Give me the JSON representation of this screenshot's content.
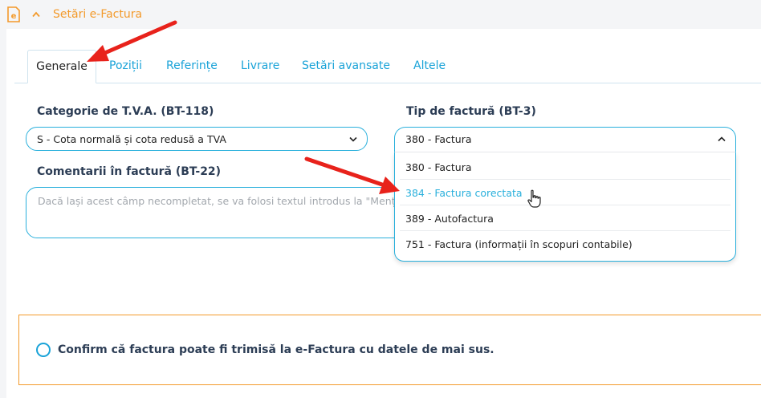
{
  "section": {
    "title": "Setări e-Factura",
    "icon": "efactura-document-icon",
    "accent_color": "#f39a2b"
  },
  "tabs": [
    {
      "label": "Generale",
      "active": true
    },
    {
      "label": "Poziții",
      "active": false
    },
    {
      "label": "Referințe",
      "active": false
    },
    {
      "label": "Livrare",
      "active": false
    },
    {
      "label": "Setări avansate",
      "active": false
    },
    {
      "label": "Altele",
      "active": false
    }
  ],
  "fields": {
    "vat_category": {
      "label": "Categorie de T.V.A. (BT-118)",
      "value": "S - Cota normală și cota redusă a TVA"
    },
    "invoice_type": {
      "label": "Tip de factură (BT-3)",
      "value": "380 - Factura",
      "options": [
        "380 - Factura",
        "384 - Factura corectata",
        "389 - Autofactura",
        "751 - Factura (informații în scopuri contabile)"
      ],
      "hovered_option": "384 - Factura corectata"
    },
    "comments": {
      "label": "Comentarii în factură (BT-22)",
      "placeholder": "Dacă lași acest câmp necompletat, se va folosi textul introdus la \"Menț"
    }
  },
  "confirm": {
    "label": "Confirm că factura poate fi trimisă la e-Factura cu datele de mai sus.",
    "checked": false
  },
  "colors": {
    "primary": "#2ab0dc",
    "tab_link": "#1aa3d8",
    "label_dark": "#2c3d55",
    "annotation_arrow": "#e8221b"
  }
}
